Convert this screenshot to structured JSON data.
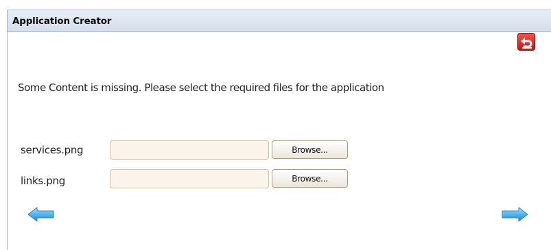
{
  "panel": {
    "title": "Application Creator"
  },
  "message": "Some Content is missing. Please select the required files for the application",
  "files": [
    {
      "label": "services.png",
      "value": "",
      "button_label": "Browse..."
    },
    {
      "label": "links.png",
      "value": "",
      "button_label": "Browse..."
    }
  ],
  "icons": {
    "undo": "undo-icon",
    "back": "arrow-left-icon",
    "forward": "arrow-right-icon"
  },
  "colors": {
    "header_bg": "#d4deeb",
    "input_bg": "#fbf4ea",
    "input_border": "#d9bf94",
    "undo_red": "#d41e1e",
    "arrow_blue": "#4fb6f0"
  }
}
